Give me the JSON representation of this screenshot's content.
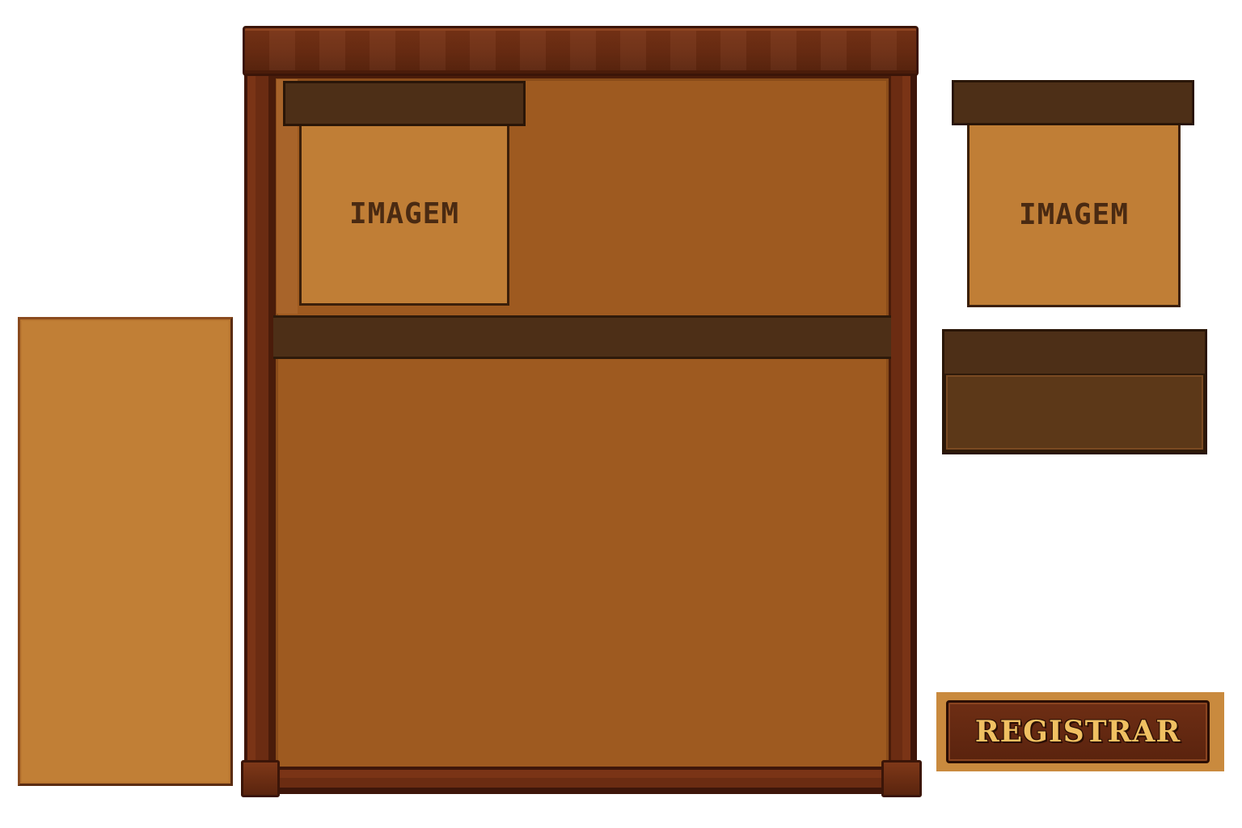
{
  "cards": [
    {
      "label": "IMAGEM"
    },
    {
      "label": "IMAGEM"
    }
  ],
  "register_button": {
    "label": "REGISTRAR"
  },
  "colors": {
    "wood_dark": "#6b2c12",
    "board": "#9e5a20",
    "panel_light": "#c17f36",
    "header_brown": "#4d2f17",
    "button_text": "#f0c062"
  }
}
